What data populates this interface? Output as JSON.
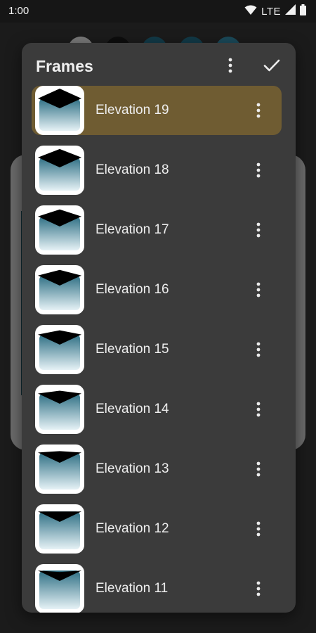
{
  "status_bar": {
    "time": "1:00",
    "network": "LTE",
    "icons": [
      "wifi-icon",
      "signal-icon",
      "battery-icon"
    ]
  },
  "background": {
    "swatch_colors": [
      "#7a7a7a",
      "#0d0d0d",
      "#123a48",
      "#123a48",
      "#1b4a5a"
    ]
  },
  "dialog": {
    "title": "Frames",
    "menu_icon": "more-vert-icon",
    "confirm_icon": "check-icon",
    "colors": {
      "background": "#3b3b3b",
      "selected_row": "#6f5c32",
      "thumbnail_gradient_top": "#2e6f84",
      "thumbnail_gradient_bottom": "#e6f2f6"
    },
    "frames": [
      {
        "label": "Elevation 19",
        "selected": true
      },
      {
        "label": "Elevation 18",
        "selected": false
      },
      {
        "label": "Elevation 17",
        "selected": false
      },
      {
        "label": "Elevation 16",
        "selected": false
      },
      {
        "label": "Elevation 15",
        "selected": false
      },
      {
        "label": "Elevation 14",
        "selected": false
      },
      {
        "label": "Elevation 13",
        "selected": false
      },
      {
        "label": "Elevation 12",
        "selected": false
      },
      {
        "label": "Elevation 11",
        "selected": false
      }
    ]
  }
}
